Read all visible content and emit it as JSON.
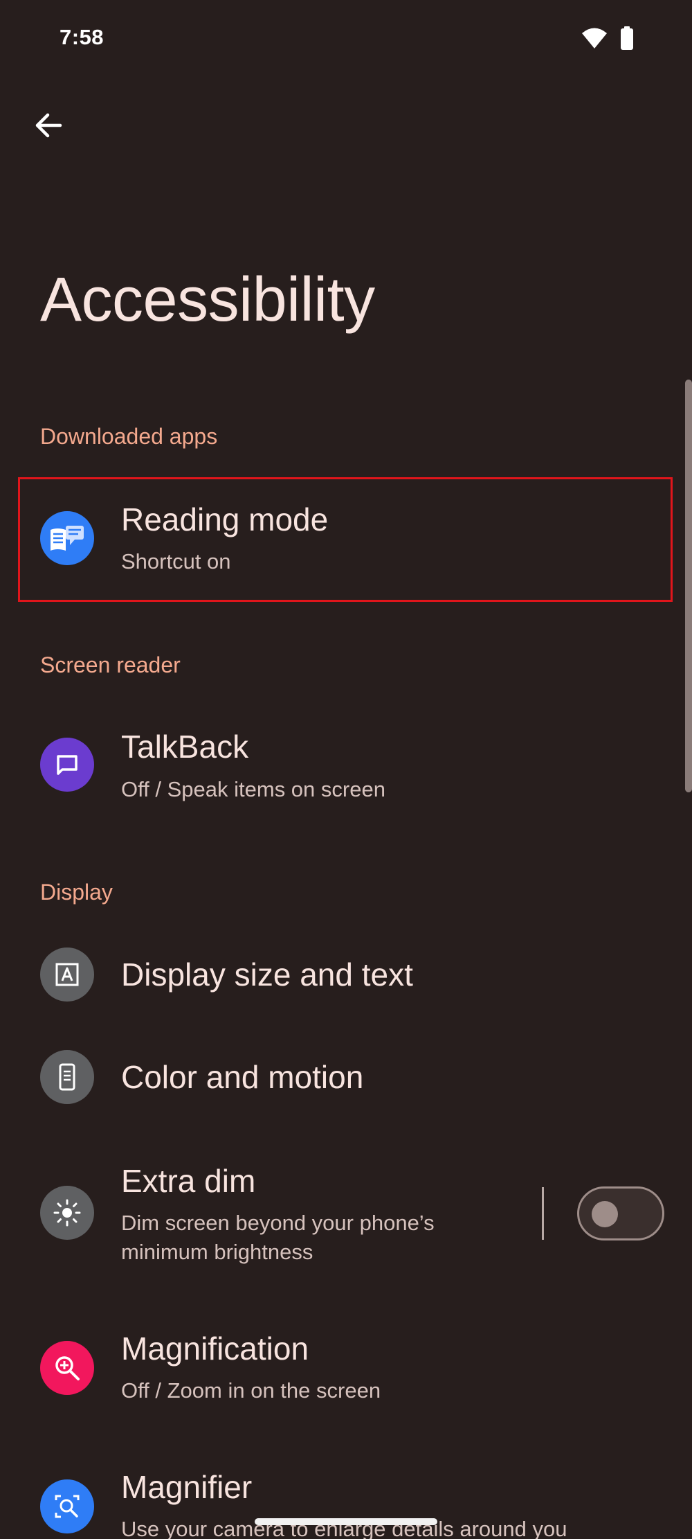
{
  "status_bar": {
    "time": "7:58",
    "wifi_icon": "wifi-icon",
    "battery_icon": "battery-icon"
  },
  "header": {
    "back_icon": "arrow-back-icon",
    "title": "Accessibility"
  },
  "sections": {
    "downloaded_apps": "Downloaded apps",
    "screen_reader": "Screen reader",
    "display": "Display"
  },
  "items": {
    "reading_mode": {
      "title": "Reading mode",
      "subtitle": "Shortcut on",
      "icon": "reading-mode-icon",
      "color": "#2f7df6"
    },
    "talkback": {
      "title": "TalkBack",
      "subtitle": "Off / Speak items on screen",
      "icon": "talkback-icon",
      "color": "#6b3ccf"
    },
    "display_size": {
      "title": "Display size and text",
      "icon": "text-size-icon",
      "color": "#5f6062"
    },
    "color_motion": {
      "title": "Color and motion",
      "icon": "phone-icon",
      "color": "#5f6062"
    },
    "extra_dim": {
      "title": "Extra dim",
      "subtitle_line1": "Dim screen beyond your phone’s",
      "subtitle_line2": "minimum brightness",
      "icon": "brightness-icon",
      "color": "#5f6062",
      "toggle_on": false
    },
    "magnification": {
      "title": "Magnification",
      "subtitle": "Off / Zoom in on the screen",
      "icon": "zoom-in-icon",
      "color": "#f2175d"
    },
    "magnifier": {
      "title": "Magnifier",
      "subtitle": "Use your camera to enlarge details around you",
      "icon": "magnifier-icon",
      "color": "#2f7df6"
    }
  }
}
